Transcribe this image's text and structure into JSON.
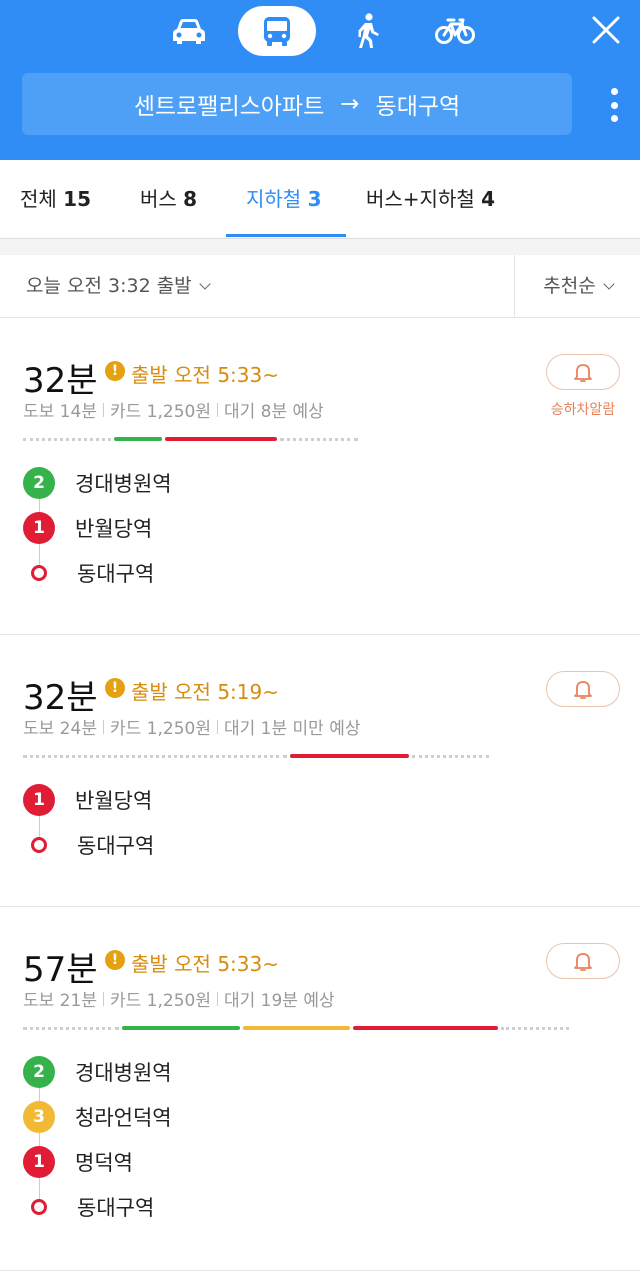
{
  "modes": [
    {
      "name": "car",
      "icon": "car-icon",
      "active": false
    },
    {
      "name": "bus",
      "icon": "bus-icon",
      "active": true
    },
    {
      "name": "walk",
      "icon": "walk-icon",
      "active": false
    },
    {
      "name": "bike",
      "icon": "bike-icon",
      "active": false
    }
  ],
  "route": {
    "origin": "센트로팰리스아파트",
    "arrow": "→",
    "destination": "동대구역"
  },
  "tabs": [
    {
      "label": "전체",
      "count": "15"
    },
    {
      "label": "버스",
      "count": "8"
    },
    {
      "label": "지하철",
      "count": "3",
      "active": true
    },
    {
      "label": "버스+지하철",
      "count": "4"
    }
  ],
  "filter": {
    "time": "오늘 오전 3:32 출발",
    "sort": "추천순"
  },
  "colors": {
    "brand": "#2f8df5",
    "line1": "#e11d36",
    "line2": "#35b24a",
    "line3": "#f2b935",
    "warning": "#e4a213"
  },
  "results": [
    {
      "duration": "32분",
      "departure": "출발 오전 5:33~",
      "walk": "도보 14분",
      "fare": "카드 1,250원",
      "wait": "대기 8분 예상",
      "alarm_label": "승하차알람",
      "segments": [
        {
          "type": "walk",
          "share": 0.27
        },
        {
          "type": "line2",
          "share": 0.15
        },
        {
          "type": "line1",
          "share": 0.34
        },
        {
          "type": "walk",
          "share": 0.24
        }
      ],
      "stops": [
        {
          "badge": "2",
          "line": "line2",
          "name": "경대병원역"
        },
        {
          "badge": "1",
          "line": "line1",
          "name": "반월당역"
        },
        {
          "badge": "",
          "line": "dest",
          "name": "동대구역"
        }
      ]
    },
    {
      "duration": "32분",
      "departure": "출발 오전 5:19~",
      "walk": "도보 24분",
      "fare": "카드 1,250원",
      "wait": "대기 1분 미만 예상",
      "alarm_label": "",
      "segments": [
        {
          "type": "walk",
          "share": 0.57
        },
        {
          "type": "line1",
          "share": 0.26
        },
        {
          "type": "walk",
          "share": 0.17
        }
      ],
      "stops": [
        {
          "badge": "1",
          "line": "line1",
          "name": "반월당역"
        },
        {
          "badge": "",
          "line": "dest",
          "name": "동대구역"
        }
      ]
    },
    {
      "duration": "57분",
      "departure": "출발 오전 5:33~",
      "walk": "도보 21분",
      "fare": "카드 1,250원",
      "wait": "대기 19분 예상",
      "alarm_label": "",
      "segments": [
        {
          "type": "walk",
          "share": 0.18
        },
        {
          "type": "line2",
          "share": 0.22
        },
        {
          "type": "line3",
          "share": 0.2
        },
        {
          "type": "line1",
          "share": 0.27
        },
        {
          "type": "walk",
          "share": 0.13
        }
      ],
      "stops": [
        {
          "badge": "2",
          "line": "line2",
          "name": "경대병원역"
        },
        {
          "badge": "3",
          "line": "line3",
          "name": "청라언덕역"
        },
        {
          "badge": "1",
          "line": "line1",
          "name": "명덕역"
        },
        {
          "badge": "",
          "line": "dest",
          "name": "동대구역"
        }
      ]
    }
  ]
}
